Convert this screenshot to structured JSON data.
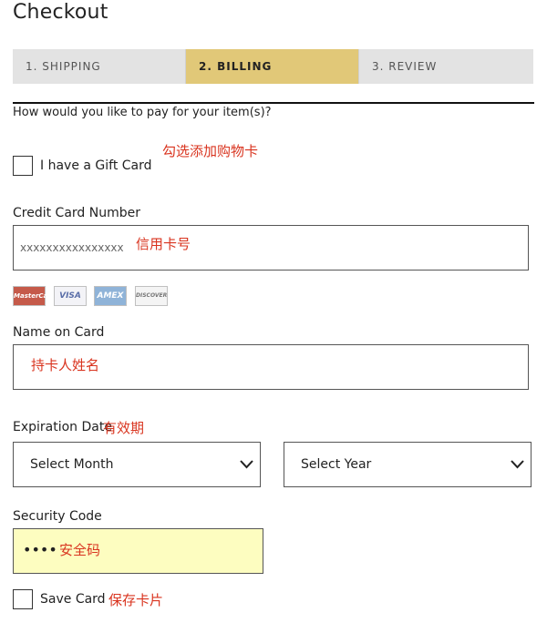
{
  "header": {
    "title": "Checkout"
  },
  "steps": [
    {
      "label": "1. SHIPPING"
    },
    {
      "label": "2. BILLING"
    },
    {
      "label": "3. REVIEW"
    }
  ],
  "billing": {
    "question": "How would you like to pay for your item(s)?",
    "gift_card": {
      "label": "I have a Gift Card",
      "annotation": "勾选添加购物卡"
    },
    "card_number": {
      "label": "Credit Card Number",
      "value": "xxxxxxxxxxxxxxxx",
      "annotation": "信用卡号"
    },
    "card_logos": [
      {
        "name": "MasterCard",
        "text": "MasterCard"
      },
      {
        "name": "Visa",
        "text": "VISA"
      },
      {
        "name": "Amex",
        "text": "AMEX"
      },
      {
        "name": "Discover",
        "text": "DISCOVER"
      }
    ],
    "name_on_card": {
      "label": "Name on Card",
      "annotation": "持卡人姓名"
    },
    "expiration": {
      "label": "Expiration Date",
      "annotation": "有效期",
      "month": "Select Month",
      "year": "Select Year"
    },
    "security_code": {
      "label": "Security Code",
      "value": "••••",
      "annotation": "安全码"
    },
    "save_card": {
      "label": "Save Card",
      "annotation": "保存卡片"
    }
  },
  "colors": {
    "active_step": "#e1c878",
    "inactive_step": "#e3e3e3",
    "security_field": "#fdfdc0",
    "annotation": "#d9341f"
  },
  "icons": {
    "dropdown": "chevron-down-icon"
  }
}
